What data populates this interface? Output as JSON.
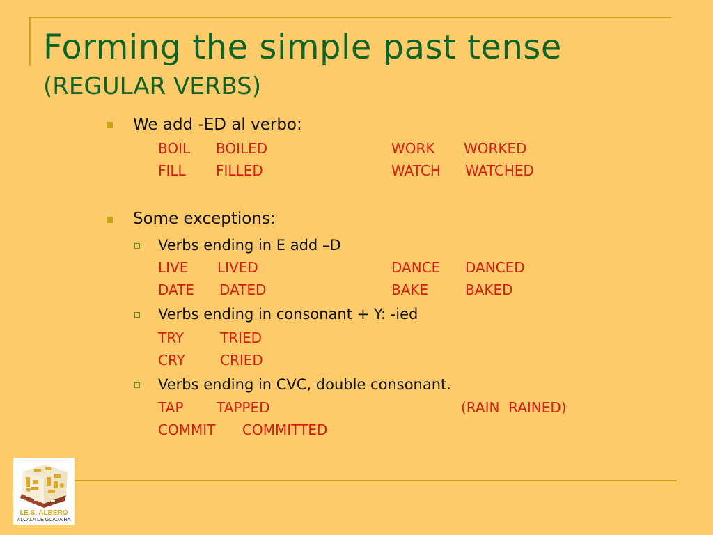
{
  "slide": {
    "title": "Forming the simple past tense",
    "subtitle": "(REGULAR VERBS)",
    "colors": {
      "background": "#fdcb6a",
      "title": "#106426",
      "examples": "#d61d14",
      "rule": "#d4a219"
    }
  },
  "section1": {
    "heading": "We add -ED al verbo:",
    "examples": [
      {
        "base": "BOIL",
        "past": "BOILED"
      },
      {
        "base": "FILL",
        "past": "FILLED"
      },
      {
        "base": "WORK",
        "past": "WORKED"
      },
      {
        "base": "WATCH",
        "past": "WATCHED"
      }
    ]
  },
  "section2": {
    "heading": "Some exceptions:",
    "rules": [
      {
        "text": "Verbs ending in E add –D",
        "examples": [
          {
            "base": "LIVE",
            "past": "LIVED"
          },
          {
            "base": "DATE",
            "past": "DATED"
          },
          {
            "base": "DANCE",
            "past": "DANCED"
          },
          {
            "base": "BAKE",
            "past": "BAKED"
          }
        ]
      },
      {
        "text": "Verbs ending in consonant + Y: -ied",
        "examples": [
          {
            "base": "TRY",
            "past": "TRIED"
          },
          {
            "base": "CRY",
            "past": "CRIED"
          }
        ]
      },
      {
        "text": "Verbs ending in CVC, double consonant.",
        "examples": [
          {
            "base": "TAP",
            "past": "TAPPED"
          },
          {
            "base": "COMMIT",
            "past": "COMMITTED"
          }
        ],
        "note": "(RAIN  RAINED)"
      }
    ]
  },
  "logo": {
    "name": "I.E.S. ALBERO",
    "city": "ALCALA DE GUADAIRA"
  }
}
